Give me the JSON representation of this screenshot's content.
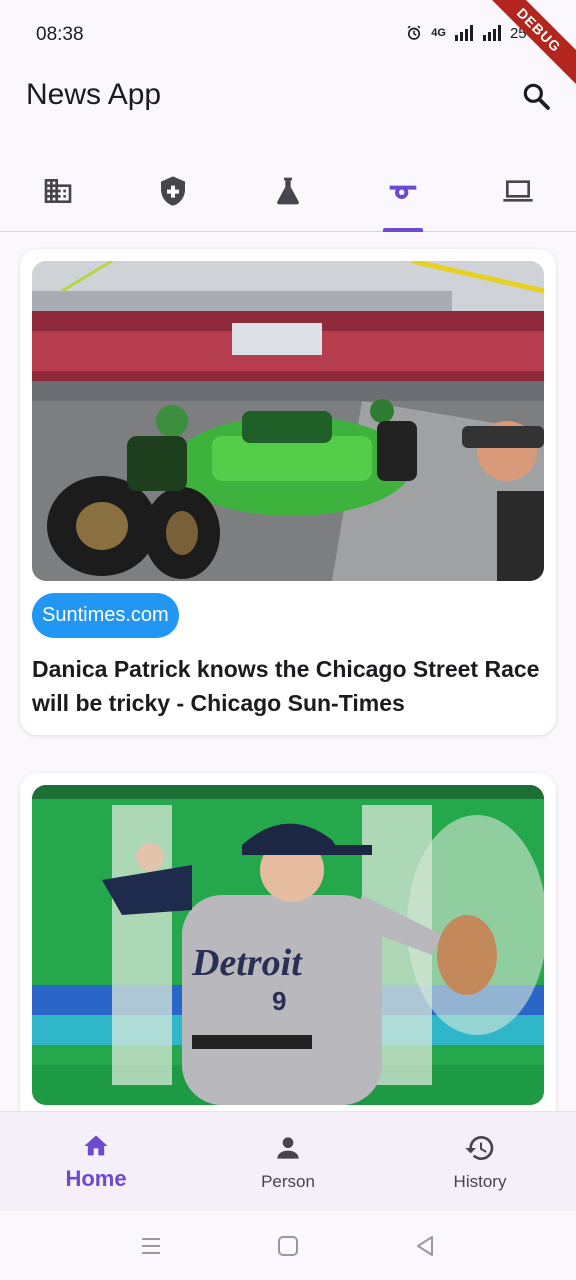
{
  "status_bar": {
    "time": "08:38",
    "battery": "25%",
    "network": "4G",
    "debug": "DEBUG"
  },
  "app_bar": {
    "title": "News App"
  },
  "tabs": [
    {
      "icon": "business-icon",
      "selected": false
    },
    {
      "icon": "health-shield-icon",
      "selected": false
    },
    {
      "icon": "science-flask-icon",
      "selected": false
    },
    {
      "icon": "sports-whistle-icon",
      "selected": true
    },
    {
      "icon": "technology-laptop-icon",
      "selected": false
    }
  ],
  "articles": [
    {
      "source": "Suntimes.com",
      "title": "Danica Patrick knows the Chicago Street Race will be tricky - Chicago Sun-Times"
    },
    {
      "source": "",
      "title": ""
    }
  ],
  "bottom_nav": [
    {
      "label": "Home",
      "icon": "home-icon",
      "selected": true
    },
    {
      "label": "Person",
      "icon": "person-icon",
      "selected": false
    },
    {
      "label": "History",
      "icon": "history-icon",
      "selected": false
    }
  ],
  "colors": {
    "accent": "#6e4ad0",
    "chip": "#2196f3",
    "background": "#fbf8fd"
  }
}
